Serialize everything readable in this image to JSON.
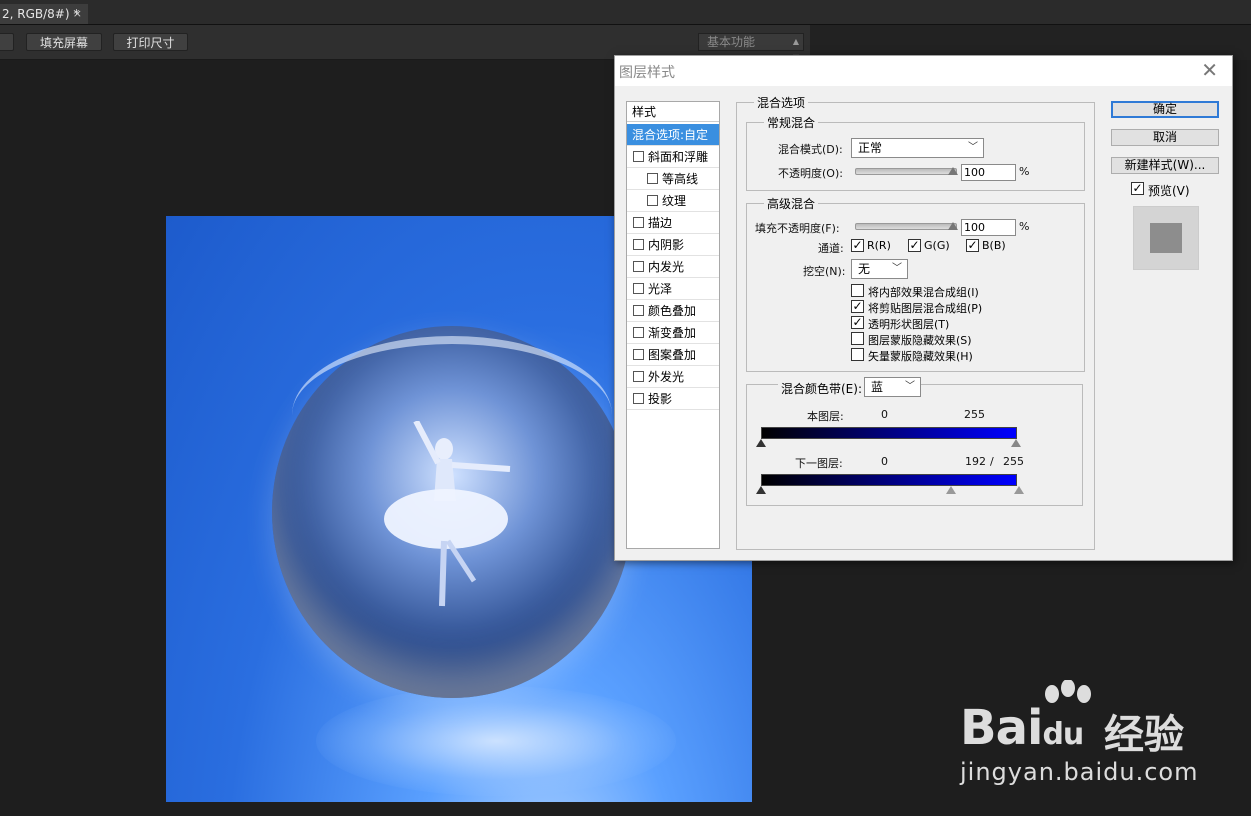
{
  "doc_tab": {
    "label": "2, RGB/8#) *",
    "close": "×"
  },
  "options_bar": {
    "fill_screen": "填充屏幕",
    "print_size": "打印尺寸",
    "workspace": "基本功能"
  },
  "dialog": {
    "title": "图层样式",
    "style_list": {
      "header": "样式",
      "items": [
        {
          "label": "混合选项:自定",
          "selected": true,
          "checkbox": false,
          "indent": false
        },
        {
          "label": "斜面和浮雕",
          "selected": false,
          "checkbox": true,
          "indent": false
        },
        {
          "label": "等高线",
          "selected": false,
          "checkbox": true,
          "indent": true
        },
        {
          "label": "纹理",
          "selected": false,
          "checkbox": true,
          "indent": true
        },
        {
          "label": "描边",
          "selected": false,
          "checkbox": true,
          "indent": false
        },
        {
          "label": "内阴影",
          "selected": false,
          "checkbox": true,
          "indent": false
        },
        {
          "label": "内发光",
          "selected": false,
          "checkbox": true,
          "indent": false
        },
        {
          "label": "光泽",
          "selected": false,
          "checkbox": true,
          "indent": false
        },
        {
          "label": "颜色叠加",
          "selected": false,
          "checkbox": true,
          "indent": false
        },
        {
          "label": "渐变叠加",
          "selected": false,
          "checkbox": true,
          "indent": false
        },
        {
          "label": "图案叠加",
          "selected": false,
          "checkbox": true,
          "indent": false
        },
        {
          "label": "外发光",
          "selected": false,
          "checkbox": true,
          "indent": false
        },
        {
          "label": "投影",
          "selected": false,
          "checkbox": true,
          "indent": false
        }
      ]
    },
    "blend": {
      "section_title": "混合选项",
      "general": {
        "title": "常规混合",
        "mode_label": "混合模式(D):",
        "mode_value": "正常",
        "opacity_label": "不透明度(O):",
        "opacity_value": "100",
        "percent": "%"
      },
      "advanced": {
        "title": "高级混合",
        "fill_label": "填充不透明度(F):",
        "fill_value": "100",
        "percent": "%",
        "channels_label": "通道:",
        "channel_r": "R(R)",
        "channel_g": "G(G)",
        "channel_b": "B(B)",
        "knockout_label": "挖空(N):",
        "knockout_value": "无",
        "options": [
          {
            "label": "将内部效果混合成组(I)",
            "checked": false
          },
          {
            "label": "将剪贴图层混合成组(P)",
            "checked": true
          },
          {
            "label": "透明形状图层(T)",
            "checked": true
          },
          {
            "label": "图层蒙版隐藏效果(S)",
            "checked": false
          },
          {
            "label": "矢量蒙版隐藏效果(H)",
            "checked": false
          }
        ]
      },
      "blend_if": {
        "label": "混合颜色带(E):",
        "value": "蓝",
        "this_layer_label": "本图层:",
        "this_low": "0",
        "this_high": "255",
        "under_layer_label": "下一图层:",
        "under_low": "0",
        "under_split_low": "192",
        "slash": "/",
        "under_high": "255"
      }
    },
    "buttons": {
      "ok": "确定",
      "cancel": "取消",
      "new_style": "新建样式(W)...",
      "preview": "预览(V)"
    },
    "check": "✓"
  },
  "watermark": {
    "logo": "Bai",
    "logo_du": "du",
    "brand_cn": "经验",
    "url": "jingyan.baidu.com"
  }
}
